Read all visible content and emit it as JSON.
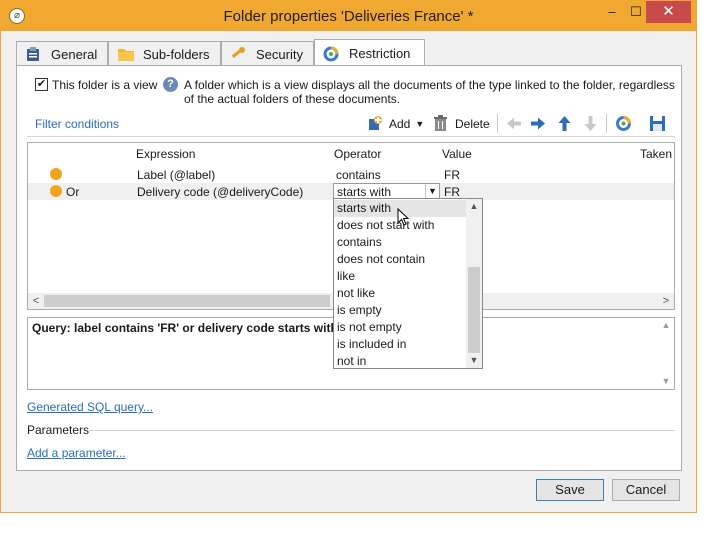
{
  "window": {
    "title": "Folder properties 'Deliveries France' *",
    "controls": {
      "minimize": "–",
      "maximize": "☐",
      "close": "✕"
    },
    "accent_color": "#f0a830"
  },
  "tabs": [
    {
      "label": "General",
      "icon": "clipboard-icon"
    },
    {
      "label": "Sub-folders",
      "icon": "folder-icon"
    },
    {
      "label": "Security",
      "icon": "key-icon"
    },
    {
      "label": "Restriction",
      "icon": "restriction-icon",
      "active": true
    }
  ],
  "view_option": {
    "checked": true,
    "check_mark": "✔",
    "label": "This folder is a view",
    "help": "A folder which is a view displays all the documents of the type linked to the folder, regardless of the actual folders of these documents."
  },
  "toolbar": {
    "filter_conditions": "Filter conditions",
    "add": "Add",
    "delete": "Delete"
  },
  "grid": {
    "columns": [
      "Expression",
      "Operator",
      "Value",
      "Taken"
    ],
    "rows": [
      {
        "prefix": "",
        "expression": "Label (@label)",
        "operator": "contains",
        "value": "FR"
      },
      {
        "prefix": "Or",
        "expression": "Delivery code (@deliveryCode)",
        "operator": "starts with",
        "value": "FR"
      }
    ]
  },
  "operator_dropdown": {
    "options": [
      "starts with",
      "does not start with",
      "contains",
      "does not contain",
      "like",
      "not like",
      "is empty",
      "is not empty",
      "is included in",
      "not in"
    ],
    "highlighted": "starts with"
  },
  "query": {
    "text": "Query: label contains 'FR' or delivery code starts with 'F"
  },
  "links": {
    "generated_sql": "Generated SQL query...",
    "parameters": "Parameters",
    "add_parameter": "Add a parameter..."
  },
  "buttons": {
    "save": "Save",
    "cancel": "Cancel"
  }
}
